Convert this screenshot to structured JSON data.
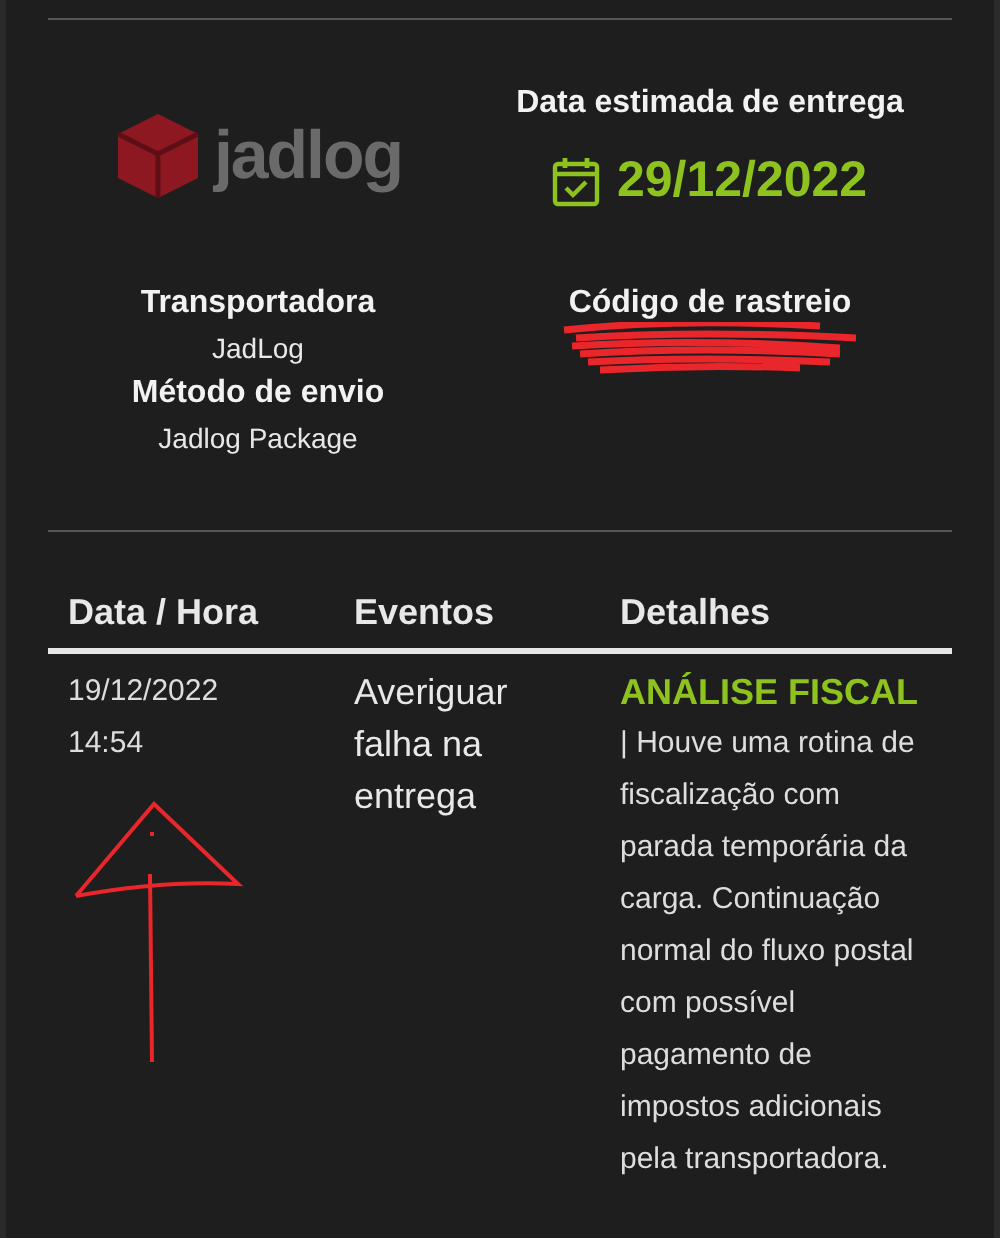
{
  "carrier_logo": {
    "text": "jadlog"
  },
  "estimated_delivery": {
    "label": "Data estimada de entrega",
    "date": "29/12/2022"
  },
  "carrier": {
    "label": "Transportadora",
    "value": "JadLog"
  },
  "shipping_method": {
    "label": "Método de envio",
    "value": "Jadlog Package"
  },
  "tracking_code": {
    "label": "Código de rastreio",
    "redacted": true
  },
  "table": {
    "columns": [
      "Data / Hora",
      "Eventos",
      "Detalhes"
    ],
    "rows": [
      {
        "date": "19/12/2022",
        "time": "14:54",
        "event": "Averiguar falha na entrega",
        "status": "ANÁLISE FISCAL",
        "details": "| Houve uma rotina de fiscalização com parada temporária da carga. Continuação normal do fluxo postal com possível pagamento de impostos adicionais pela transportadora."
      }
    ]
  }
}
